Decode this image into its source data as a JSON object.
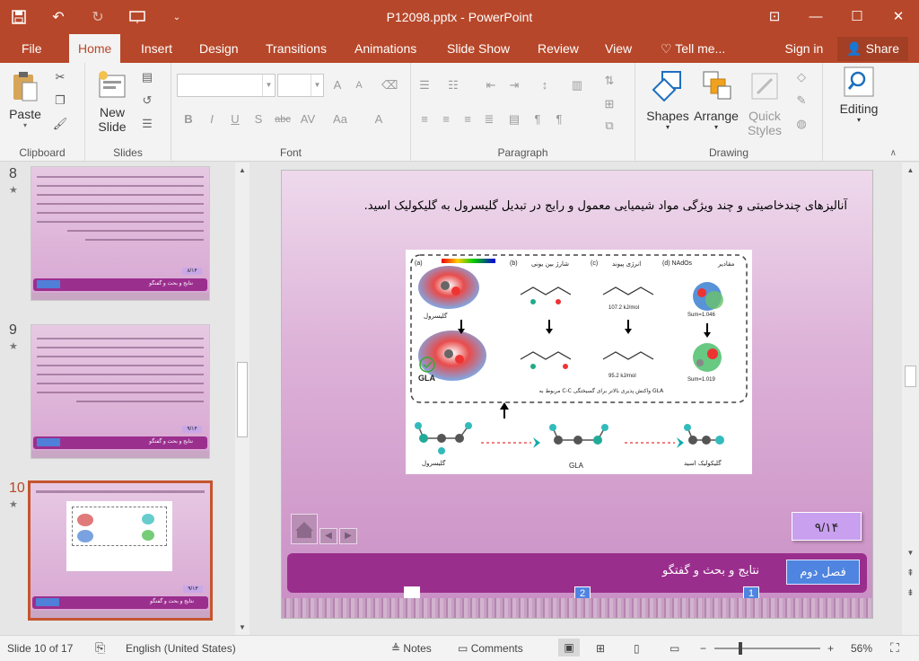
{
  "window": {
    "title": "P12098.pptx - PowerPoint",
    "controls": [
      "restore",
      "minimize",
      "maximize",
      "close"
    ]
  },
  "quick_access": [
    "save-icon",
    "undo-icon",
    "redo-icon",
    "present-icon",
    "customize-icon"
  ],
  "tabs": [
    "File",
    "Home",
    "Insert",
    "Design",
    "Transitions",
    "Animations",
    "Slide Show",
    "Review",
    "View"
  ],
  "active_tab": "Home",
  "tell_me": "Tell me...",
  "sign_in": "Sign in",
  "share": "Share",
  "ribbon": {
    "clipboard": {
      "label": "Clipboard",
      "paste": "Paste"
    },
    "slides": {
      "label": "Slides",
      "new_slide": "New",
      "new_slide2": "Slide"
    },
    "font": {
      "label": "Font",
      "bold": "B",
      "italic": "I",
      "underline": "U",
      "shadow": "S",
      "strike": "abc",
      "spacing": "AV",
      "case": "Aa",
      "color": "A"
    },
    "paragraph": {
      "label": "Paragraph"
    },
    "drawing": {
      "label": "Drawing",
      "shapes": "Shapes",
      "arrange": "Arrange",
      "quick_styles": "Quick",
      "quick_styles2": "Styles"
    },
    "editing": {
      "label": "Editing"
    }
  },
  "thumbnails": [
    {
      "number": "8",
      "page": "۸/۱۴"
    },
    {
      "number": "9",
      "page": "۹/۱۴"
    },
    {
      "number": "10",
      "page": "۹/۱۴"
    }
  ],
  "slide": {
    "heading": "آنالیزهای چندخاصیتی و چند ویژگی مواد شیمیایی معمول و رایج در تبدیل گلیسرول به گلیکولیک اسید.",
    "figure_labels": {
      "a": "(a)",
      "b": "(b)",
      "c": "(c)",
      "d": "(d) NAdOs",
      "a_title": "گلیسرول",
      "b_title": "شارژ بین یونی",
      "c_title": "انرژی پیوند",
      "d_title": "مقادیر",
      "gla": "GLA",
      "caption": "GLA واکنش پذیری بالاتر برای گسیختگی C-C مربوط به",
      "e1": "107.2 kJ/mol",
      "e2": "95.2 kJ/mol",
      "s1": "Sum=1.046",
      "s2": "Sum=1.019",
      "bottom_left": "گلیسرول",
      "bottom_mid": "GLA",
      "bottom_right": "گلیکولیک اسید"
    },
    "page": "۹/۱۴",
    "footer_part": "فصل دوم",
    "footer_title": "نتایج و بحث و گفتگو",
    "pager_2": "2",
    "pager_1": "1"
  },
  "status": {
    "slide": "Slide 10 of 17",
    "language": "English (United States)",
    "notes": "Notes",
    "comments": "Comments",
    "zoom": "56%"
  }
}
